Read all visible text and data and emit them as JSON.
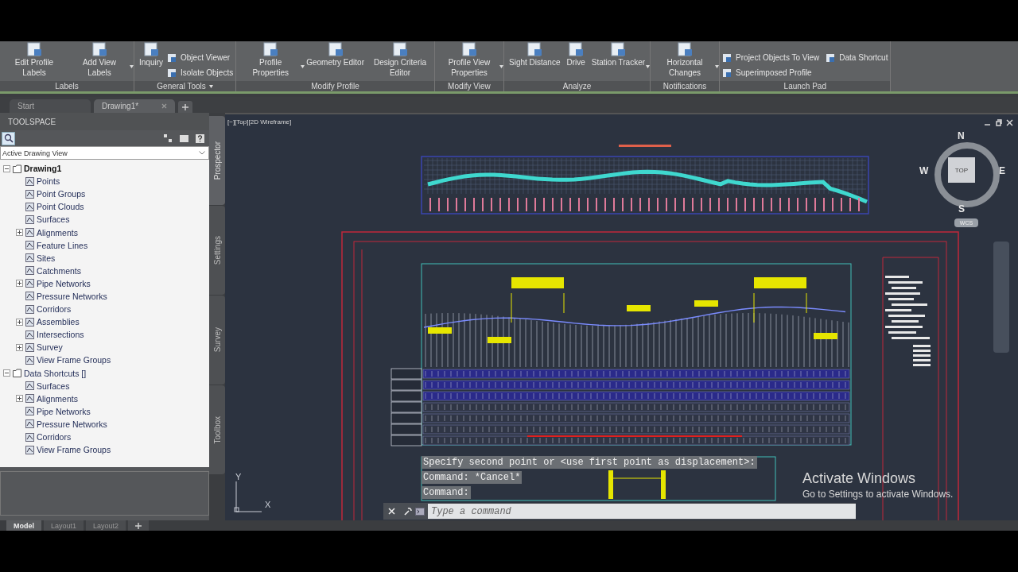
{
  "ribbon": {
    "panels": [
      {
        "title": "Labels",
        "tools": [
          {
            "kind": "large",
            "label": "Edit Profile Labels"
          },
          {
            "kind": "large",
            "label": "Add View Labels",
            "dropdown": true
          }
        ]
      },
      {
        "title": "General Tools",
        "has_menu": true,
        "tools": [
          {
            "kind": "large",
            "label": "Inquiry"
          },
          {
            "kind": "small",
            "label": "Object Viewer"
          },
          {
            "kind": "small",
            "label": "Isolate Objects"
          }
        ]
      },
      {
        "title": "Modify Profile",
        "tools": [
          {
            "kind": "large",
            "label": "Profile Properties",
            "dropdown": true
          },
          {
            "kind": "large",
            "label": "Geometry Editor"
          },
          {
            "kind": "large",
            "label": "Design Criteria Editor"
          }
        ]
      },
      {
        "title": "Modify View",
        "tools": [
          {
            "kind": "large",
            "label": "Profile View Properties",
            "dropdown": true
          }
        ]
      },
      {
        "title": "Analyze",
        "tools": [
          {
            "kind": "large",
            "label": "Sight Distance"
          },
          {
            "kind": "large",
            "label": "Drive"
          },
          {
            "kind": "large",
            "label": "Station Tracker",
            "dropdown": true
          }
        ]
      },
      {
        "title": "Notifications",
        "tools": [
          {
            "kind": "large",
            "label": "Horizontal Changes",
            "dropdown": true
          }
        ]
      },
      {
        "title": "Launch Pad",
        "tools": [
          {
            "kind": "small",
            "label": "Project Objects To View"
          },
          {
            "kind": "small",
            "label": "Superimposed Profile"
          },
          {
            "kind": "small",
            "label": "Data Shortcut"
          }
        ]
      }
    ]
  },
  "doc_tabs": [
    {
      "label": "Start",
      "selected": false
    },
    {
      "label": "Drawing1*",
      "selected": true,
      "closable": true
    }
  ],
  "toolspace": {
    "title": "TOOLSPACE",
    "view_select": "Active Drawing View",
    "tree": [
      {
        "label": "Drawing1",
        "expanded": true,
        "bold": true,
        "children": [
          {
            "label": "Points"
          },
          {
            "label": "Point Groups"
          },
          {
            "label": "Point Clouds"
          },
          {
            "label": "Surfaces"
          },
          {
            "label": "Alignments",
            "expanded": false
          },
          {
            "label": "Feature Lines"
          },
          {
            "label": "Sites"
          },
          {
            "label": "Catchments"
          },
          {
            "label": "Pipe Networks",
            "expanded": false
          },
          {
            "label": "Pressure Networks"
          },
          {
            "label": "Corridors"
          },
          {
            "label": "Assemblies",
            "expanded": false
          },
          {
            "label": "Intersections"
          },
          {
            "label": "Survey",
            "expanded": false
          },
          {
            "label": "View Frame Groups"
          }
        ]
      },
      {
        "label": "Data Shortcuts []",
        "expanded": true,
        "children": [
          {
            "label": "Surfaces"
          },
          {
            "label": "Alignments",
            "expanded": false
          },
          {
            "label": "Pipe Networks"
          },
          {
            "label": "Pressure Networks"
          },
          {
            "label": "Corridors"
          },
          {
            "label": "View Frame Groups"
          }
        ]
      }
    ],
    "side_tabs": [
      {
        "label": "Prospector",
        "selected": true
      },
      {
        "label": "Settings",
        "selected": false
      },
      {
        "label": "Survey",
        "selected": false
      },
      {
        "label": "Toolbox",
        "selected": false
      }
    ]
  },
  "viewport": {
    "label": "[−][Top][2D Wireframe]",
    "viewcube": {
      "north": "N",
      "south": "S",
      "east": "E",
      "west": "W",
      "face": "TOP",
      "ucs": "WCS"
    },
    "ucs_icon": {
      "x": "X",
      "y": "Y"
    },
    "command_history": [
      "Specify second point or <use first point as displacement>:",
      "Command: *Cancel*",
      "Command:"
    ],
    "command_line": {
      "placeholder": "Type a command"
    },
    "activation": {
      "title": "Activate Windows",
      "text": "Go to Settings to activate Windows."
    }
  },
  "layout_tabs": [
    {
      "label": "Model",
      "selected": true
    },
    {
      "label": "Layout1",
      "selected": false
    },
    {
      "label": "Layout2",
      "selected": false
    }
  ]
}
